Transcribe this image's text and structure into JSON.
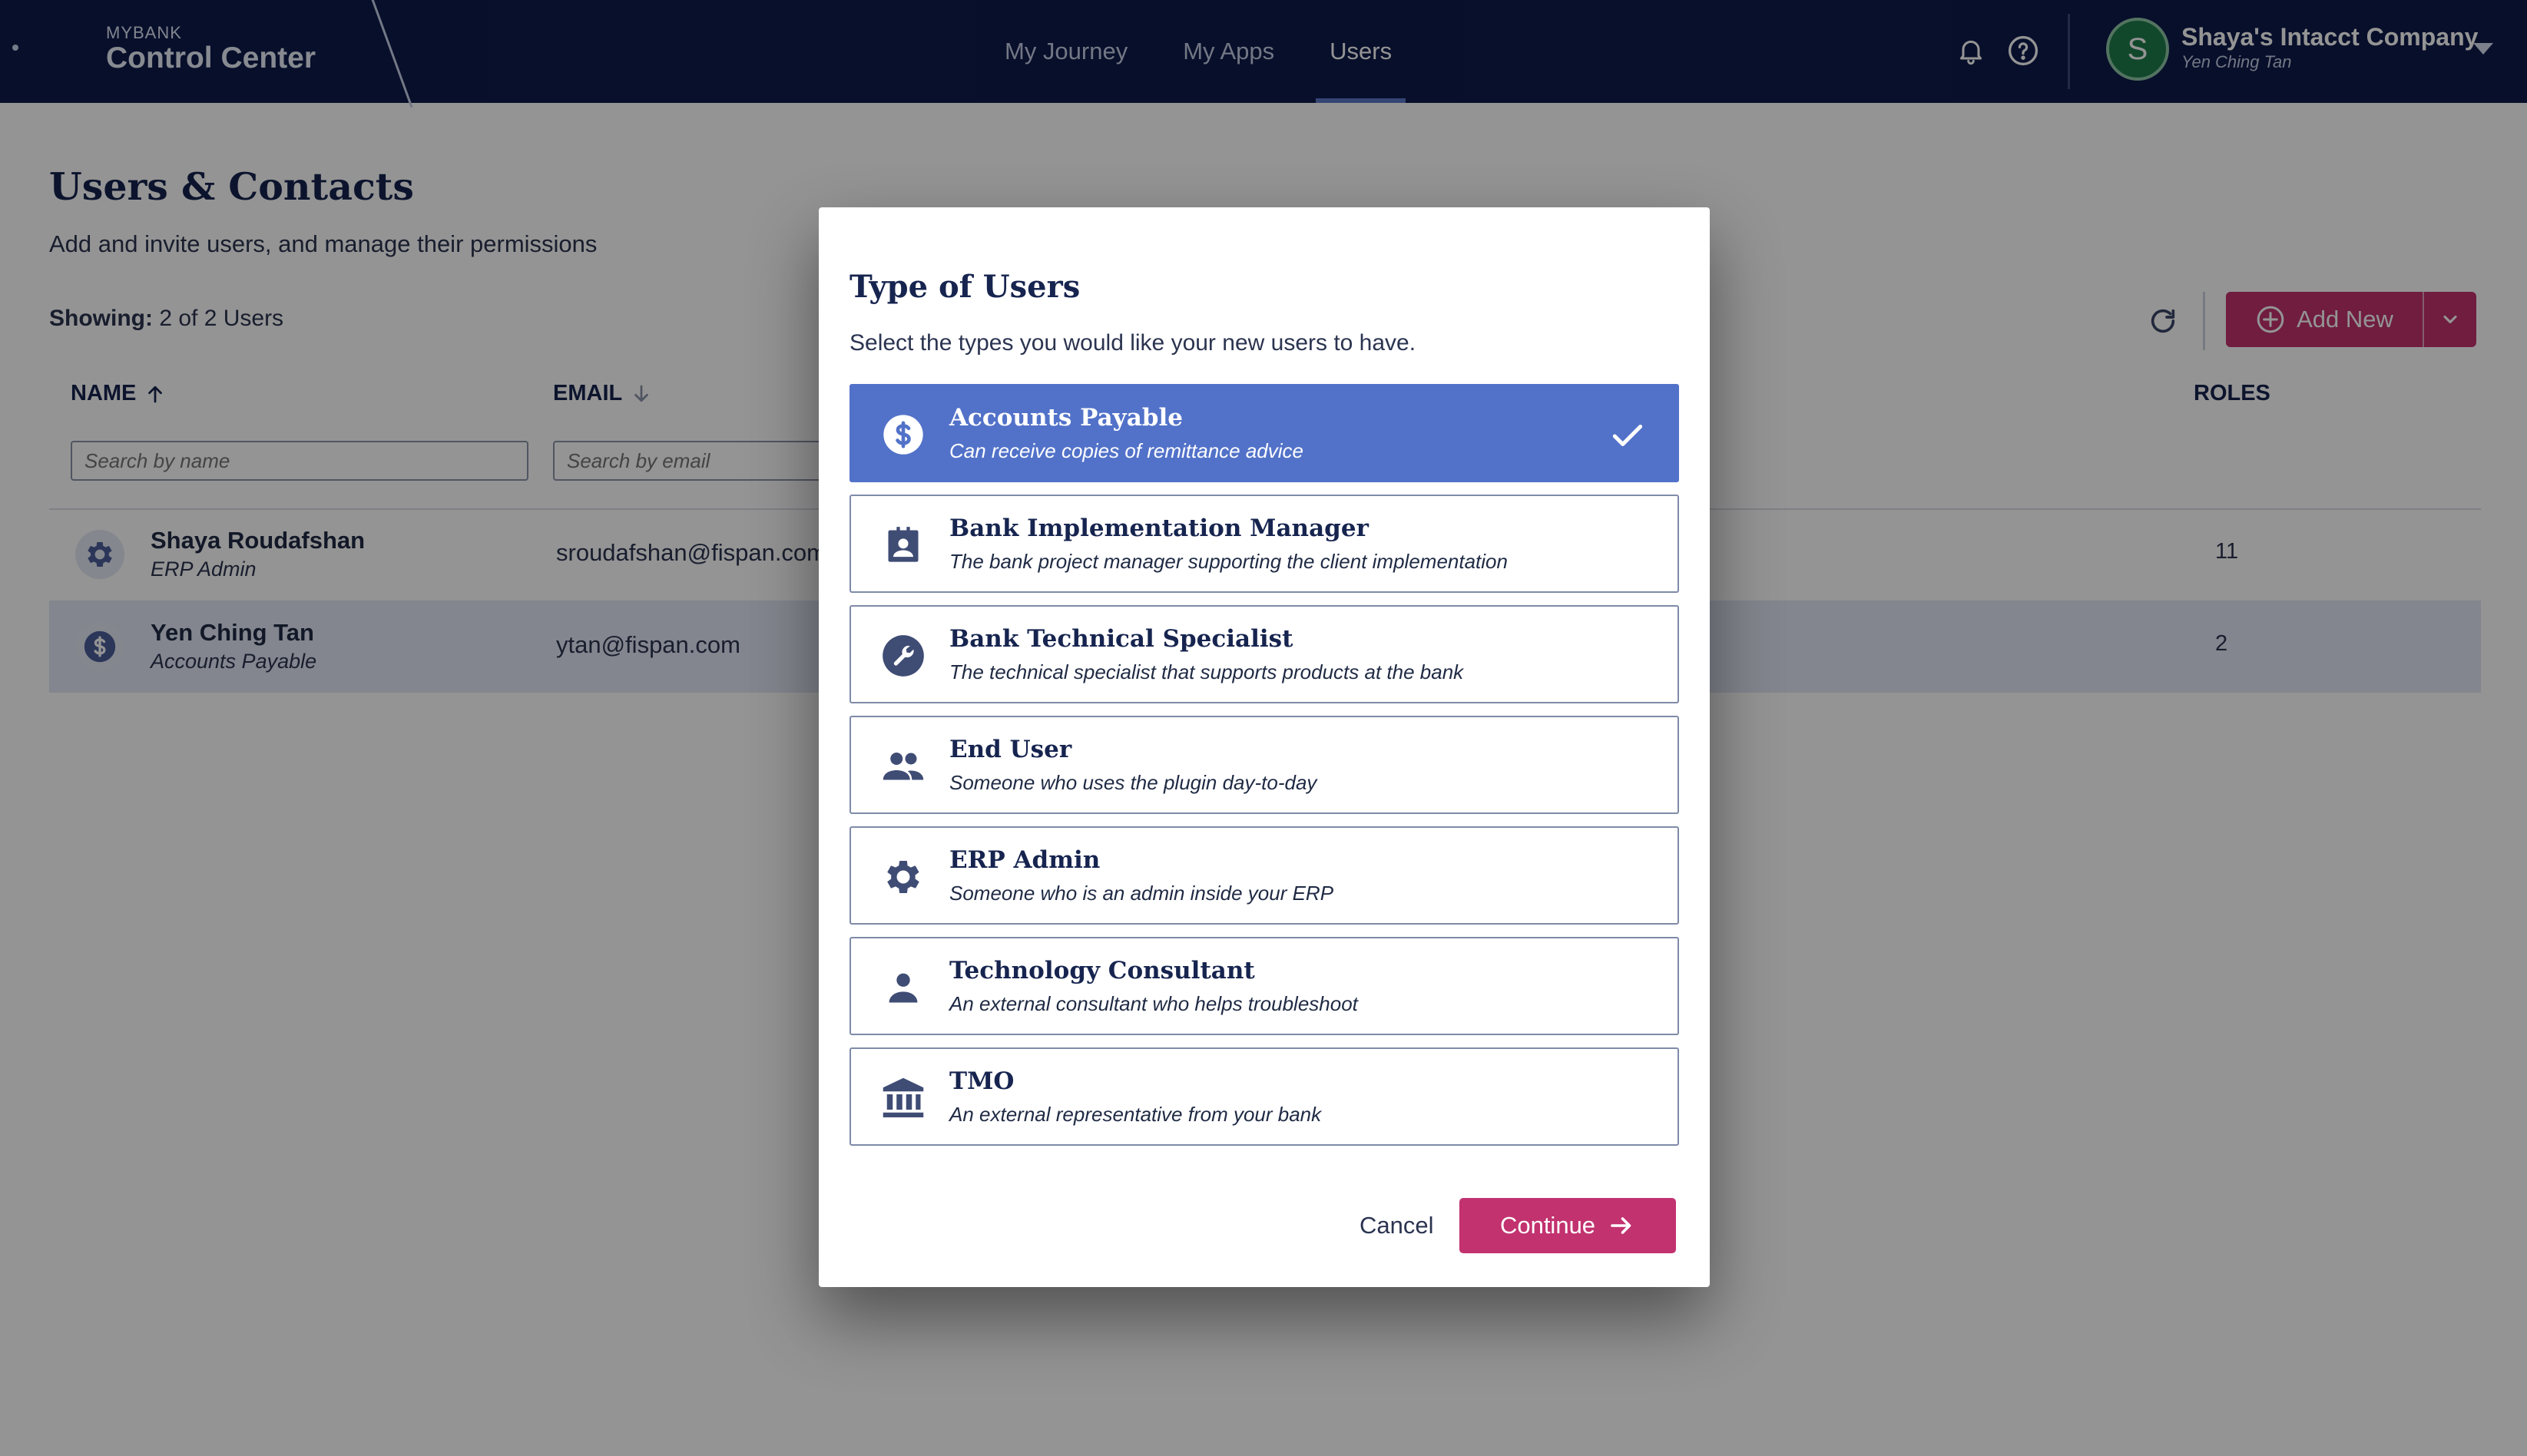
{
  "header": {
    "brand_small": "MYBANK",
    "brand_title": "Control Center",
    "nav": [
      {
        "label": "My Journey",
        "active": false
      },
      {
        "label": "My Apps",
        "active": false
      },
      {
        "label": "Users",
        "active": true
      }
    ],
    "icons": [
      "bell-icon",
      "help-icon"
    ],
    "account": {
      "initial": "S",
      "company": "Shaya's Intacct Company",
      "user": "Yen Ching Tan"
    }
  },
  "page": {
    "title": "Users & Contacts",
    "subtitle": "Add and invite users, and manage their permissions",
    "showing_label": "Showing:",
    "showing_value": "2 of 2 Users",
    "add_new_label": "Add New"
  },
  "table": {
    "columns": {
      "name": "NAME",
      "email": "EMAIL",
      "roles": "ROLES"
    },
    "name_filter_placeholder": "Search by name",
    "email_filter_placeholder": "Search by email",
    "rows": [
      {
        "icon": "gear-icon",
        "name": "Shaya Roudafshan",
        "role": "ERP Admin",
        "email": "sroudafshan@fispan.com",
        "roles": "11"
      },
      {
        "icon": "dollar-icon",
        "name": "Yen Ching Tan",
        "role": "Accounts Payable",
        "email": "ytan@fispan.com",
        "roles": "2"
      }
    ]
  },
  "modal": {
    "title": "Type of Users",
    "subtitle": "Select the types you would like your new users to have.",
    "options": [
      {
        "icon": "dollar-icon",
        "label": "Accounts Payable",
        "description": "Can receive copies of remittance advice",
        "selected": true
      },
      {
        "icon": "badge-icon",
        "label": "Bank Implementation Manager",
        "description": "The bank project manager supporting the client implementation",
        "selected": false
      },
      {
        "icon": "wrench-icon",
        "label": "Bank Technical Specialist",
        "description": "The technical specialist that supports products at the bank",
        "selected": false
      },
      {
        "icon": "people-icon",
        "label": "End User",
        "description": "Someone who uses the plugin day-to-day",
        "selected": false
      },
      {
        "icon": "gear-icon",
        "label": "ERP Admin",
        "description": "Someone who is an admin inside your ERP",
        "selected": false
      },
      {
        "icon": "person-icon",
        "label": "Technology Consultant",
        "description": "An external consultant who helps troubleshoot",
        "selected": false
      },
      {
        "icon": "bank-icon",
        "label": "TMO",
        "description": "An external representative from your bank",
        "selected": false
      }
    ],
    "cancel_label": "Cancel",
    "continue_label": "Continue"
  },
  "colors": {
    "topbar": "#0d1b4a",
    "accent_pink": "#c2326f",
    "selected_blue": "#5272c9",
    "avatar_green": "#1e7d4b"
  }
}
